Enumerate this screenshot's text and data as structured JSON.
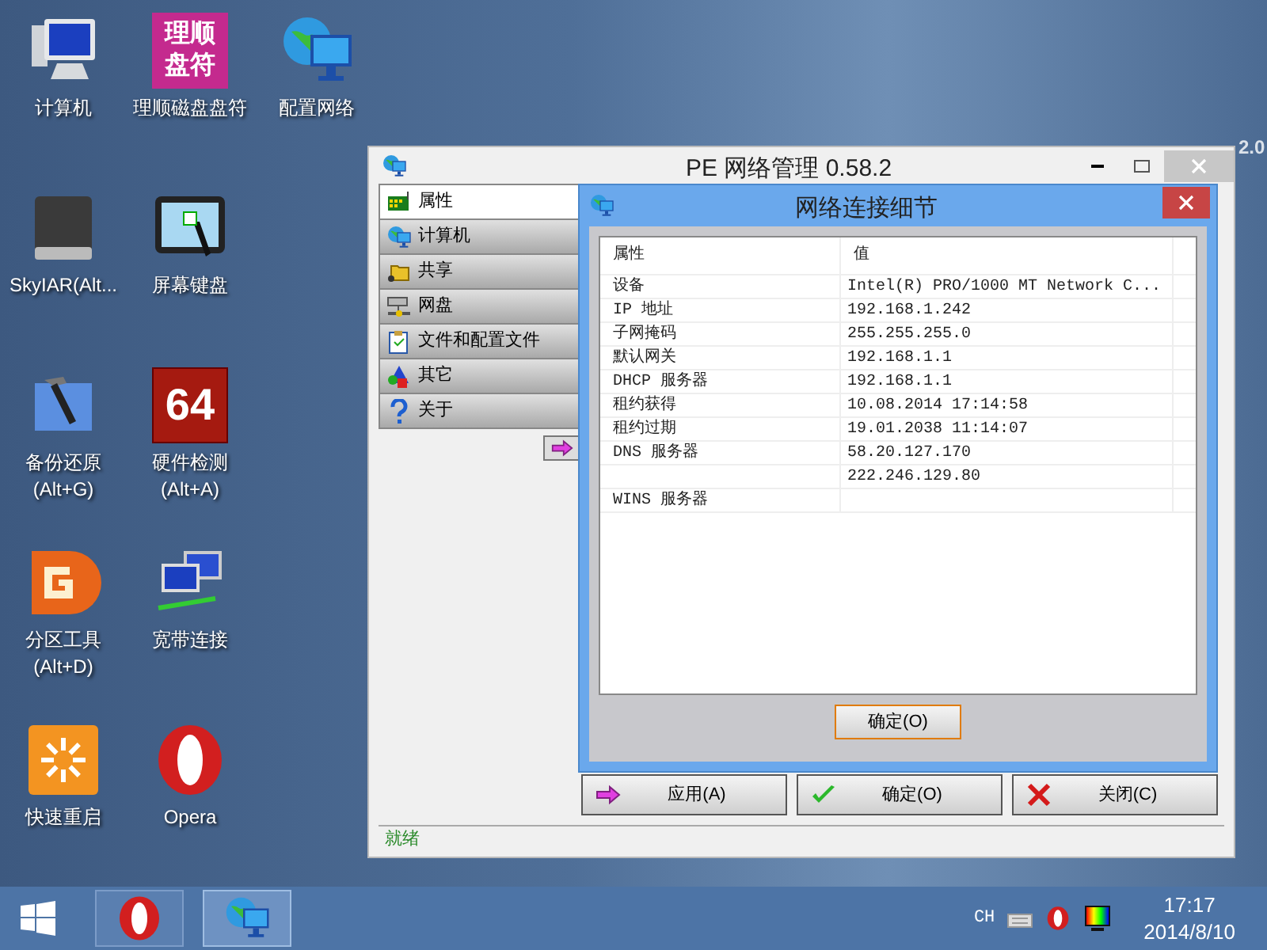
{
  "desktop_icons": [
    {
      "label": "计算机",
      "kind": "computer"
    },
    {
      "label": "SkyIAR(Alt...",
      "kind": "drive"
    },
    {
      "label": "备份还原\n(Alt+G)",
      "kind": "hammer"
    },
    {
      "label": "分区工具\n(Alt+D)",
      "kind": "partition"
    },
    {
      "label": "快速重启",
      "kind": "restart"
    },
    {
      "label": "理顺磁盘盘符",
      "kind": "textlogo",
      "logo": [
        "理顺",
        "盘符"
      ]
    },
    {
      "label": "屏幕键盘",
      "kind": "keyboard"
    },
    {
      "label": "硬件检测\n(Alt+A)",
      "kind": "textlogo64",
      "logo": "64"
    },
    {
      "label": "宽带连接",
      "kind": "network"
    },
    {
      "label": "Opera",
      "kind": "opera"
    },
    {
      "label": "配置网络",
      "kind": "globe"
    }
  ],
  "wallpaper_text": "2.0",
  "main_window": {
    "title": "PE 网络管理 0.58.2",
    "nav": [
      {
        "label": "属性",
        "selected": true,
        "kind": "card"
      },
      {
        "label": "计算机",
        "selected": false,
        "kind": "globe"
      },
      {
        "label": "共享",
        "selected": false,
        "kind": "folder"
      },
      {
        "label": "网盘",
        "selected": false,
        "kind": "server"
      },
      {
        "label": "文件和配置文件",
        "selected": false,
        "kind": "clipboard"
      },
      {
        "label": "其它",
        "selected": false,
        "kind": "shapes"
      },
      {
        "label": "关于",
        "selected": false,
        "kind": "question"
      }
    ],
    "buttons": [
      {
        "label": "应用(A)",
        "kind": "apply"
      },
      {
        "label": "确定(O)",
        "kind": "ok"
      },
      {
        "label": "关闭(C)",
        "kind": "close"
      }
    ],
    "status": "就绪"
  },
  "dialog": {
    "title": "网络连接细节",
    "columns": [
      "属性",
      "值"
    ],
    "rows": [
      {
        "property": "设备",
        "value": "Intel(R) PRO/1000 MT Network C..."
      },
      {
        "property": "IP 地址",
        "value": "192.168.1.242"
      },
      {
        "property": "子网掩码",
        "value": "255.255.255.0"
      },
      {
        "property": "默认网关",
        "value": "192.168.1.1"
      },
      {
        "property": "DHCP 服务器",
        "value": "192.168.1.1"
      },
      {
        "property": "租约获得",
        "value": "10.08.2014 17:14:58"
      },
      {
        "property": "租约过期",
        "value": "19.01.2038 11:14:07"
      },
      {
        "property": "DNS 服务器",
        "value": "58.20.127.170"
      },
      {
        "property": "",
        "value": "222.246.129.80"
      },
      {
        "property": "WINS 服务器",
        "value": ""
      }
    ],
    "ok_button": "确定(O)"
  },
  "taskbar": {
    "apps": [
      {
        "kind": "opera",
        "selected": false
      },
      {
        "kind": "globe",
        "selected": true
      }
    ],
    "tray": {
      "language": "CH",
      "time": "17:17",
      "date": "2014/8/10"
    }
  }
}
